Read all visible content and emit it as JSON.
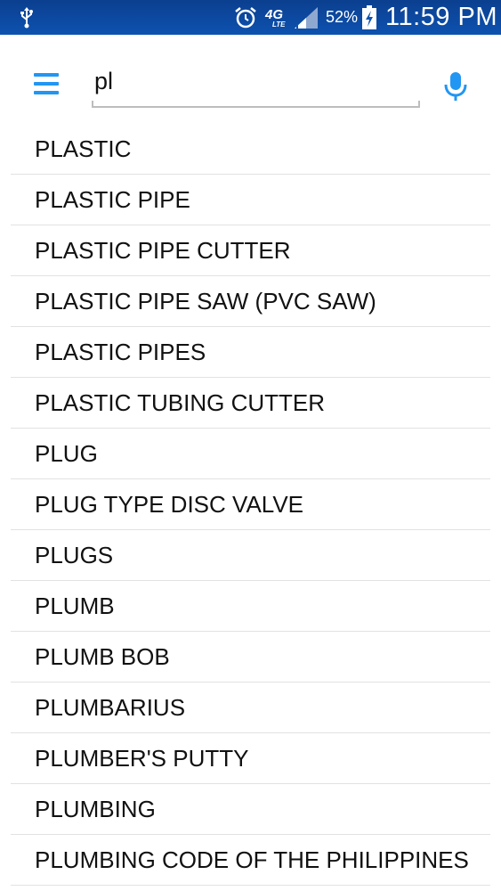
{
  "status_bar": {
    "network": "4G",
    "network_sub": "LTE",
    "battery_percent": "52%",
    "time": "11:59 PM",
    "icons": [
      "usb-icon",
      "alarm-icon",
      "signal-icon",
      "battery-charging-icon"
    ]
  },
  "search": {
    "value": "pl",
    "menu_icon": "menu-icon",
    "mic_icon": "mic-icon"
  },
  "colors": {
    "status_bar": "#0d52b0",
    "accent": "#2196f3",
    "divider": "#e2e2e2",
    "text": "#111111"
  },
  "results": [
    "PLASTIC",
    "PLASTIC PIPE",
    "PLASTIC PIPE CUTTER",
    "PLASTIC PIPE SAW (PVC SAW)",
    "PLASTIC PIPES",
    "PLASTIC TUBING CUTTER",
    "PLUG",
    "PLUG TYPE DISC VALVE",
    "PLUGS",
    "PLUMB",
    "PLUMB BOB",
    "PLUMBARIUS",
    "PLUMBER'S PUTTY",
    "PLUMBING",
    "PLUMBING CODE OF THE PHILIPPINES"
  ]
}
